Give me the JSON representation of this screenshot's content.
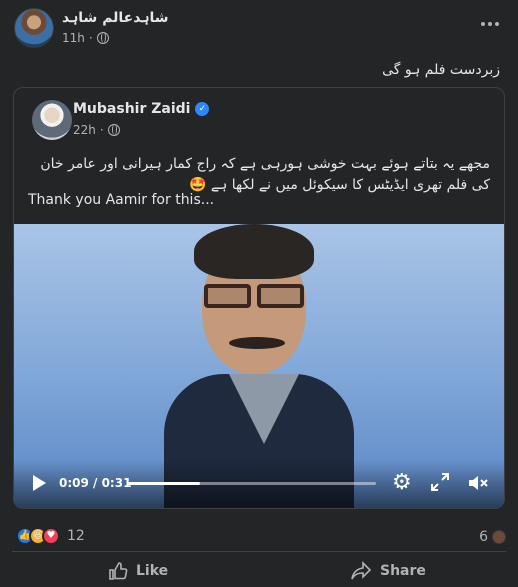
{
  "outer_post": {
    "author": "شاہدعالم شاہد",
    "time": "11h",
    "text": "زبردست فلم ہو گی"
  },
  "shared_post": {
    "author": "Mubashir Zaidi",
    "time": "22h",
    "urdu_text": "مجھے یہ بتاتے ہوئے بہت خوشی ہورہی ہے کہ راج کمار ہیرانی اور عامر خان کی فلم تھری ایڈیٹس کا سیکوئل میں نے لکھا ہے 🤩",
    "english_text": "Thank you Aamir for this..."
  },
  "video": {
    "time_display": "0:09 / 0:31",
    "progress": 0.29
  },
  "footer": {
    "reaction_count": "12",
    "right_count": "6",
    "like_label": "Like",
    "share_label": "Share"
  },
  "icons": {
    "more": "more-options-icon",
    "globe": "globe-icon",
    "verified": "verified-badge-icon",
    "play": "play-icon",
    "settings": "gear-icon",
    "fullscreen": "expand-icon",
    "volume": "volume-mute-icon",
    "like": "thumbs-up-icon",
    "share": "share-arrow-icon"
  },
  "colors": {
    "accent": "#2d88ff",
    "like_reaction": "#2078f4",
    "love_reaction": "#f33e58",
    "haha_reaction": "#f7b125"
  }
}
